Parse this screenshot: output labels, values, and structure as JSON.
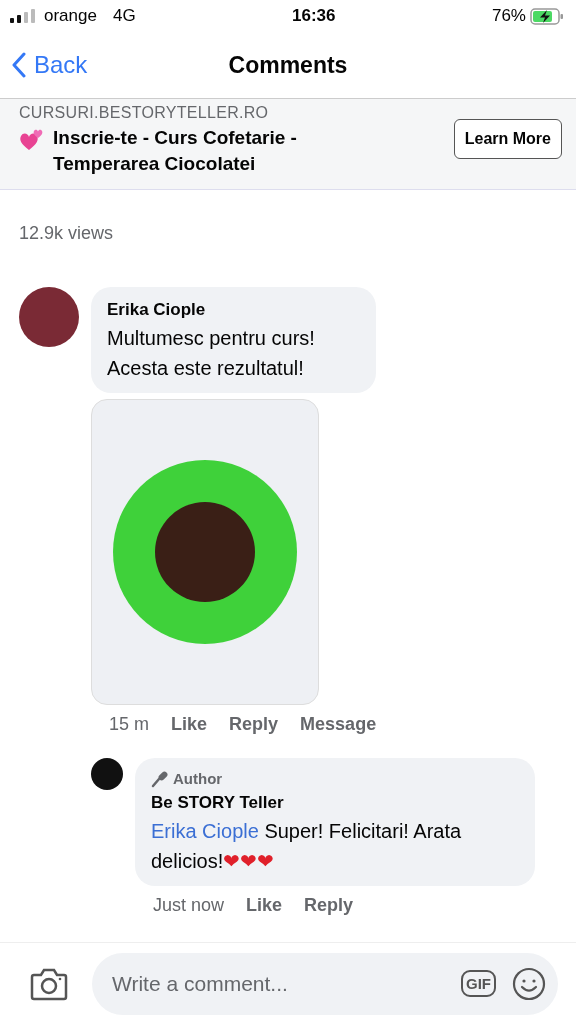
{
  "status_bar": {
    "carrier": "orange",
    "network": "4G",
    "time": "16:36",
    "battery": "76%"
  },
  "nav": {
    "back": "Back",
    "title": "Comments"
  },
  "ad": {
    "domain": "CURSURI.BESTORYTELLER.RO",
    "title": "Inscrie-te - Curs Cofetarie - Temperarea Ciocolatei",
    "button": "Learn More"
  },
  "views": "12.9k views",
  "comments": [
    {
      "author": "Erika Ciople",
      "text": "Multumesc pentru curs! Acesta este rezultatul!",
      "has_photo": true,
      "time": "15 m",
      "actions": [
        "Like",
        "Reply",
        "Message"
      ],
      "reply": false
    },
    {
      "author": "Be STORY Teller",
      "badge": "Author",
      "mention": "Erika Ciople",
      "text": "Super! Felicitari! Arata delicios!",
      "emoji": "❤❤❤",
      "has_photo": false,
      "time": "Just now",
      "actions": [
        "Like",
        "Reply"
      ],
      "reply": true
    }
  ],
  "composer": {
    "placeholder": "Write a comment...",
    "gif": "GIF"
  }
}
